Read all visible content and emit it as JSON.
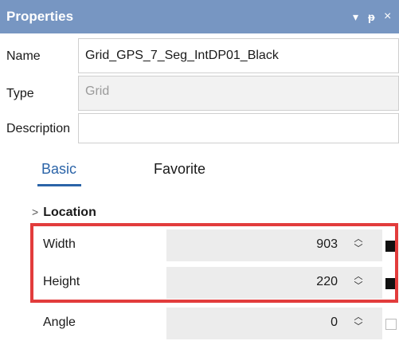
{
  "panel": {
    "title": "Properties",
    "controls": {
      "menu": "▾",
      "pin": "ᵽ",
      "close": "×"
    }
  },
  "fields": {
    "name": {
      "label": "Name",
      "value": "Grid_GPS_7_Seg_IntDP01_Black"
    },
    "type": {
      "label": "Type",
      "value": "Grid"
    },
    "description": {
      "label": "Description",
      "value": ""
    }
  },
  "tabs": [
    {
      "label": "Basic",
      "active": true
    },
    {
      "label": "Favorite",
      "active": false
    }
  ],
  "section": {
    "label": "Location",
    "chevron": ">"
  },
  "properties": [
    {
      "label": "Width",
      "value": "903",
      "color": "#111111",
      "highlighted": true
    },
    {
      "label": "Height",
      "value": "220",
      "color": "#111111",
      "highlighted": true
    },
    {
      "label": "Angle",
      "value": "0",
      "color": "#ffffff",
      "highlighted": false
    }
  ],
  "accent_color": "#7796c2",
  "highlight_color": "#e23c3c"
}
